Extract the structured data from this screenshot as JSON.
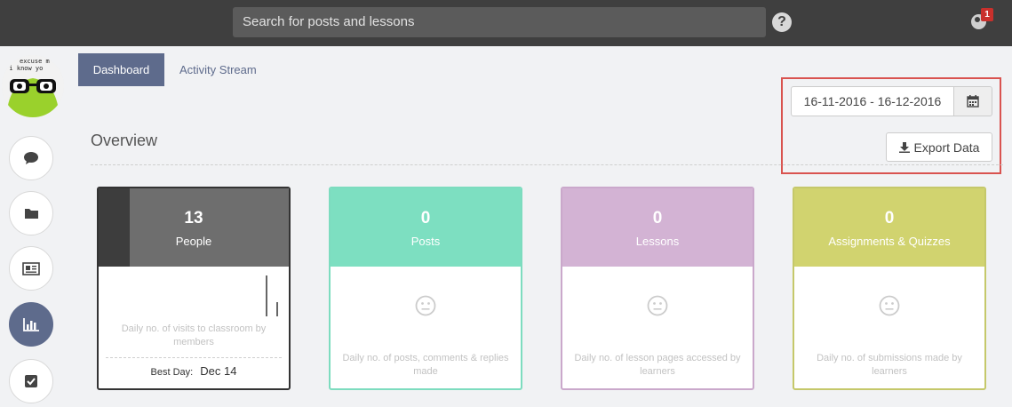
{
  "search": {
    "placeholder": "Search for posts and lessons"
  },
  "notifications": {
    "count": "1"
  },
  "help": {
    "glyph": "?"
  },
  "sidebar": {
    "avatar_text": [
      "excuse m",
      "o i know yo"
    ],
    "items": [
      {
        "name": "comments",
        "icon": "speech-bubble-icon"
      },
      {
        "name": "files",
        "icon": "folder-icon"
      },
      {
        "name": "lessons",
        "icon": "newspaper-icon"
      },
      {
        "name": "analytics",
        "icon": "bar-chart-icon",
        "active": true
      },
      {
        "name": "tasks",
        "icon": "checkbox-icon"
      }
    ]
  },
  "tabs": [
    {
      "label": "Dashboard",
      "active": true
    },
    {
      "label": "Activity Stream",
      "active": false
    }
  ],
  "date_range": {
    "value": "16-11-2016 - 16-12-2016"
  },
  "export": {
    "label": "Export Data"
  },
  "overview": {
    "title": "Overview"
  },
  "cards": [
    {
      "count": "13",
      "label": "People",
      "description": "Daily no. of visits to classroom by members",
      "best_day_label": "Best Day:",
      "best_day_value": "Dec 14",
      "color": "#6e6e6e"
    },
    {
      "count": "0",
      "label": "Posts",
      "description": "Daily no. of posts, comments & replies made",
      "color": "#7ddfc1"
    },
    {
      "count": "0",
      "label": "Lessons",
      "description": "Daily no. of lesson pages accessed by learners",
      "color": "#d3b3d4"
    },
    {
      "count": "0",
      "label": "Assignments & Quizzes",
      "description": "Daily no. of submissions made by learners",
      "color": "#d1d36f"
    }
  ],
  "colors": {
    "accent": "#5e6b8c",
    "topbar": "#3f3f3f",
    "highlight": "#d9534f"
  }
}
